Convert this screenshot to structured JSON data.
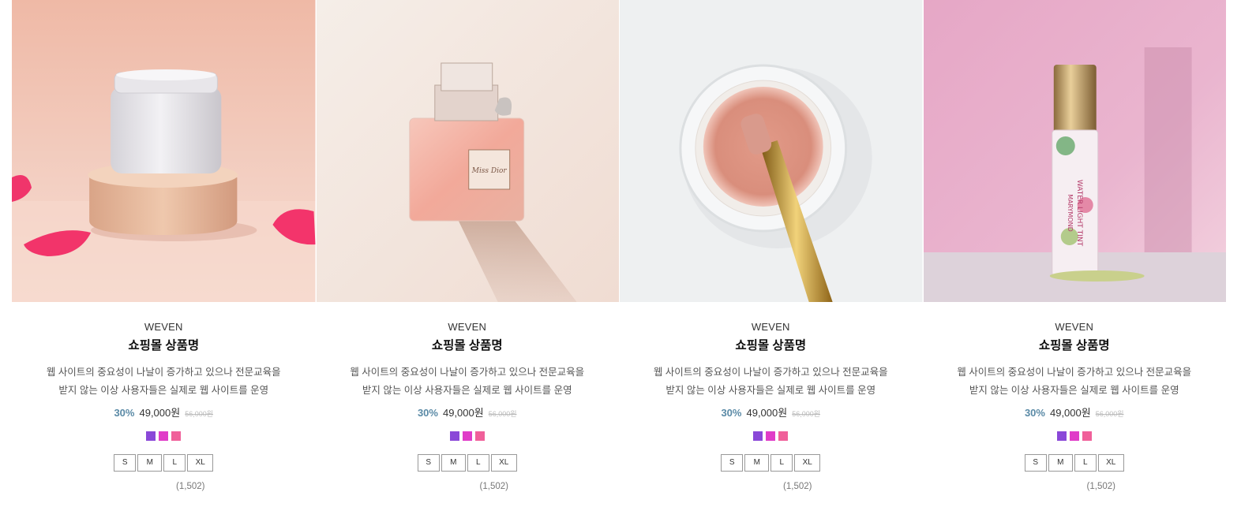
{
  "products": [
    {
      "brand": "WEVEN",
      "name": "쇼핑몰 상품명",
      "desc_line1": "웹 사이트의 중요성이 나날이 증가하고 있으나 전문교육을",
      "desc_line2": "받지 않는 이상 사용자들은 실제로 웹 사이트를 운영",
      "discount": "30%",
      "price": "49,000원",
      "original_price": "56,000원",
      "colors": [
        "#8a48d8",
        "#e03cc8",
        "#f0609a"
      ],
      "sizes": [
        "S",
        "M",
        "L",
        "XL"
      ],
      "reviews": "(1,502)",
      "image_icon": "cream-jar-image"
    },
    {
      "brand": "WEVEN",
      "name": "쇼핑몰 상품명",
      "desc_line1": "웹 사이트의 중요성이 나날이 증가하고 있으나 전문교육을",
      "desc_line2": "받지 않는 이상 사용자들은 실제로 웹 사이트를 운영",
      "discount": "30%",
      "price": "49,000원",
      "original_price": "56,000원",
      "colors": [
        "#8a48d8",
        "#e03cc8",
        "#f0609a"
      ],
      "sizes": [
        "S",
        "M",
        "L",
        "XL"
      ],
      "reviews": "(1,502)",
      "image_icon": "perfume-bottle-image",
      "bottle_label": "Miss Dior"
    },
    {
      "brand": "WEVEN",
      "name": "쇼핑몰 상품명",
      "desc_line1": "웹 사이트의 중요성이 나날이 증가하고 있으나 전문교육을",
      "desc_line2": "받지 않는 이상 사용자들은 실제로 웹 사이트를 운영",
      "discount": "30%",
      "price": "49,000원",
      "original_price": "56,000원",
      "colors": [
        "#8a48d8",
        "#e03cc8",
        "#f0609a"
      ],
      "sizes": [
        "S",
        "M",
        "L",
        "XL"
      ],
      "reviews": "(1,502)",
      "image_icon": "powder-brush-image"
    },
    {
      "brand": "WEVEN",
      "name": "쇼핑몰 상품명",
      "desc_line1": "웹 사이트의 중요성이 나날이 증가하고 있으나 전문교육을",
      "desc_line2": "받지 않는 이상 사용자들은 실제로 웹 사이트를 운영",
      "discount": "30%",
      "price": "49,000원",
      "original_price": "56,000원",
      "colors": [
        "#8a48d8",
        "#e03cc8",
        "#f0609a"
      ],
      "sizes": [
        "S",
        "M",
        "L",
        "XL"
      ],
      "reviews": "(1,502)",
      "image_icon": "lip-tint-image",
      "tint_label_1": "WATER LIGHT TINT",
      "tint_label_2": "MARYMOND"
    }
  ]
}
